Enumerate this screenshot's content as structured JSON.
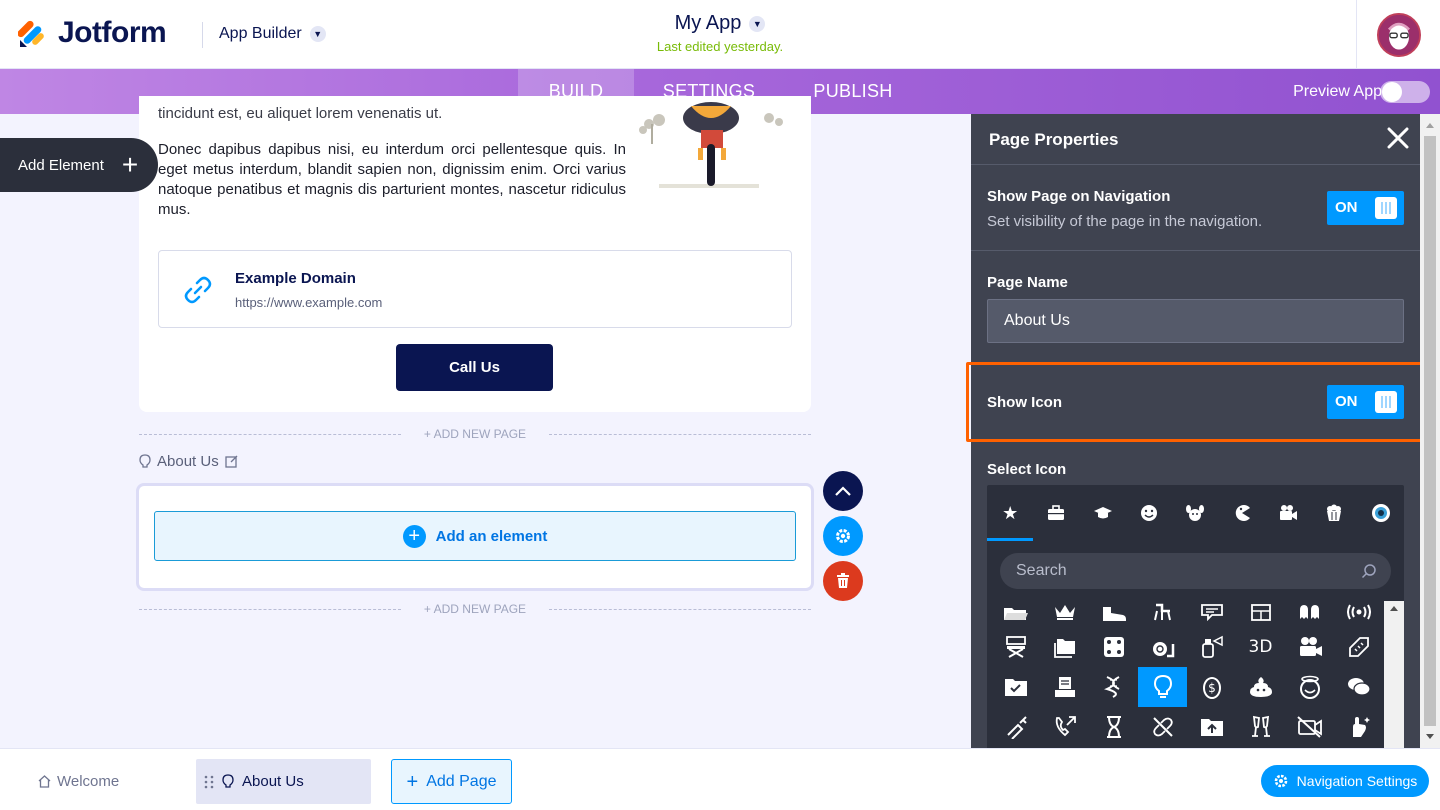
{
  "header": {
    "brand": "Jotform",
    "product": "App Builder",
    "app_name": "My App",
    "last_edited": "Last edited yesterday."
  },
  "nav": {
    "tabs": [
      {
        "label": "BUILD",
        "active": true
      },
      {
        "label": "SETTINGS",
        "active": false
      },
      {
        "label": "PUBLISH",
        "active": false
      }
    ],
    "preview_label": "Preview App",
    "preview_on": false
  },
  "sidebar": {
    "add_element": "Add Element"
  },
  "canvas": {
    "partial_text": "tincidunt est, eu aliquet lorem venenatis ut.",
    "paragraph": "Donec dapibus dapibus nisi, eu interdum orci pellentesque quis. In eget metus interdum, blandit sapien non, dignissim enim. Orci varius natoque penatibus et magnis dis parturient montes, nascetur ridiculus mus.",
    "link": {
      "title": "Example Domain",
      "url": "https://www.example.com"
    },
    "call_button": "Call Us",
    "add_new_page": "+ ADD NEW PAGE",
    "page_label": "About Us",
    "add_an_element": "Add an element"
  },
  "panel": {
    "title": "Page Properties",
    "show_nav": {
      "label": "Show Page on Navigation",
      "sub": "Set visibility of the page in the navigation.",
      "state": "ON"
    },
    "page_name": {
      "label": "Page Name",
      "value": "About Us"
    },
    "show_icon": {
      "label": "Show Icon",
      "state": "ON"
    },
    "select_icon": {
      "label": "Select Icon",
      "search_placeholder": "Search",
      "selected_icon": "lightbulb-icon"
    }
  },
  "bottom": {
    "pages": [
      {
        "label": "Welcome",
        "icon": "home-icon"
      },
      {
        "label": "About Us",
        "icon": "lightbulb-icon",
        "active": true
      }
    ],
    "add_page": "Add Page",
    "nav_settings": "Navigation Settings"
  },
  "colors": {
    "accent": "#0099ff",
    "navy": "#0a1551",
    "panel_bg": "#3f4350",
    "highlight": "#ff6100",
    "delete": "#dc3a1e"
  }
}
